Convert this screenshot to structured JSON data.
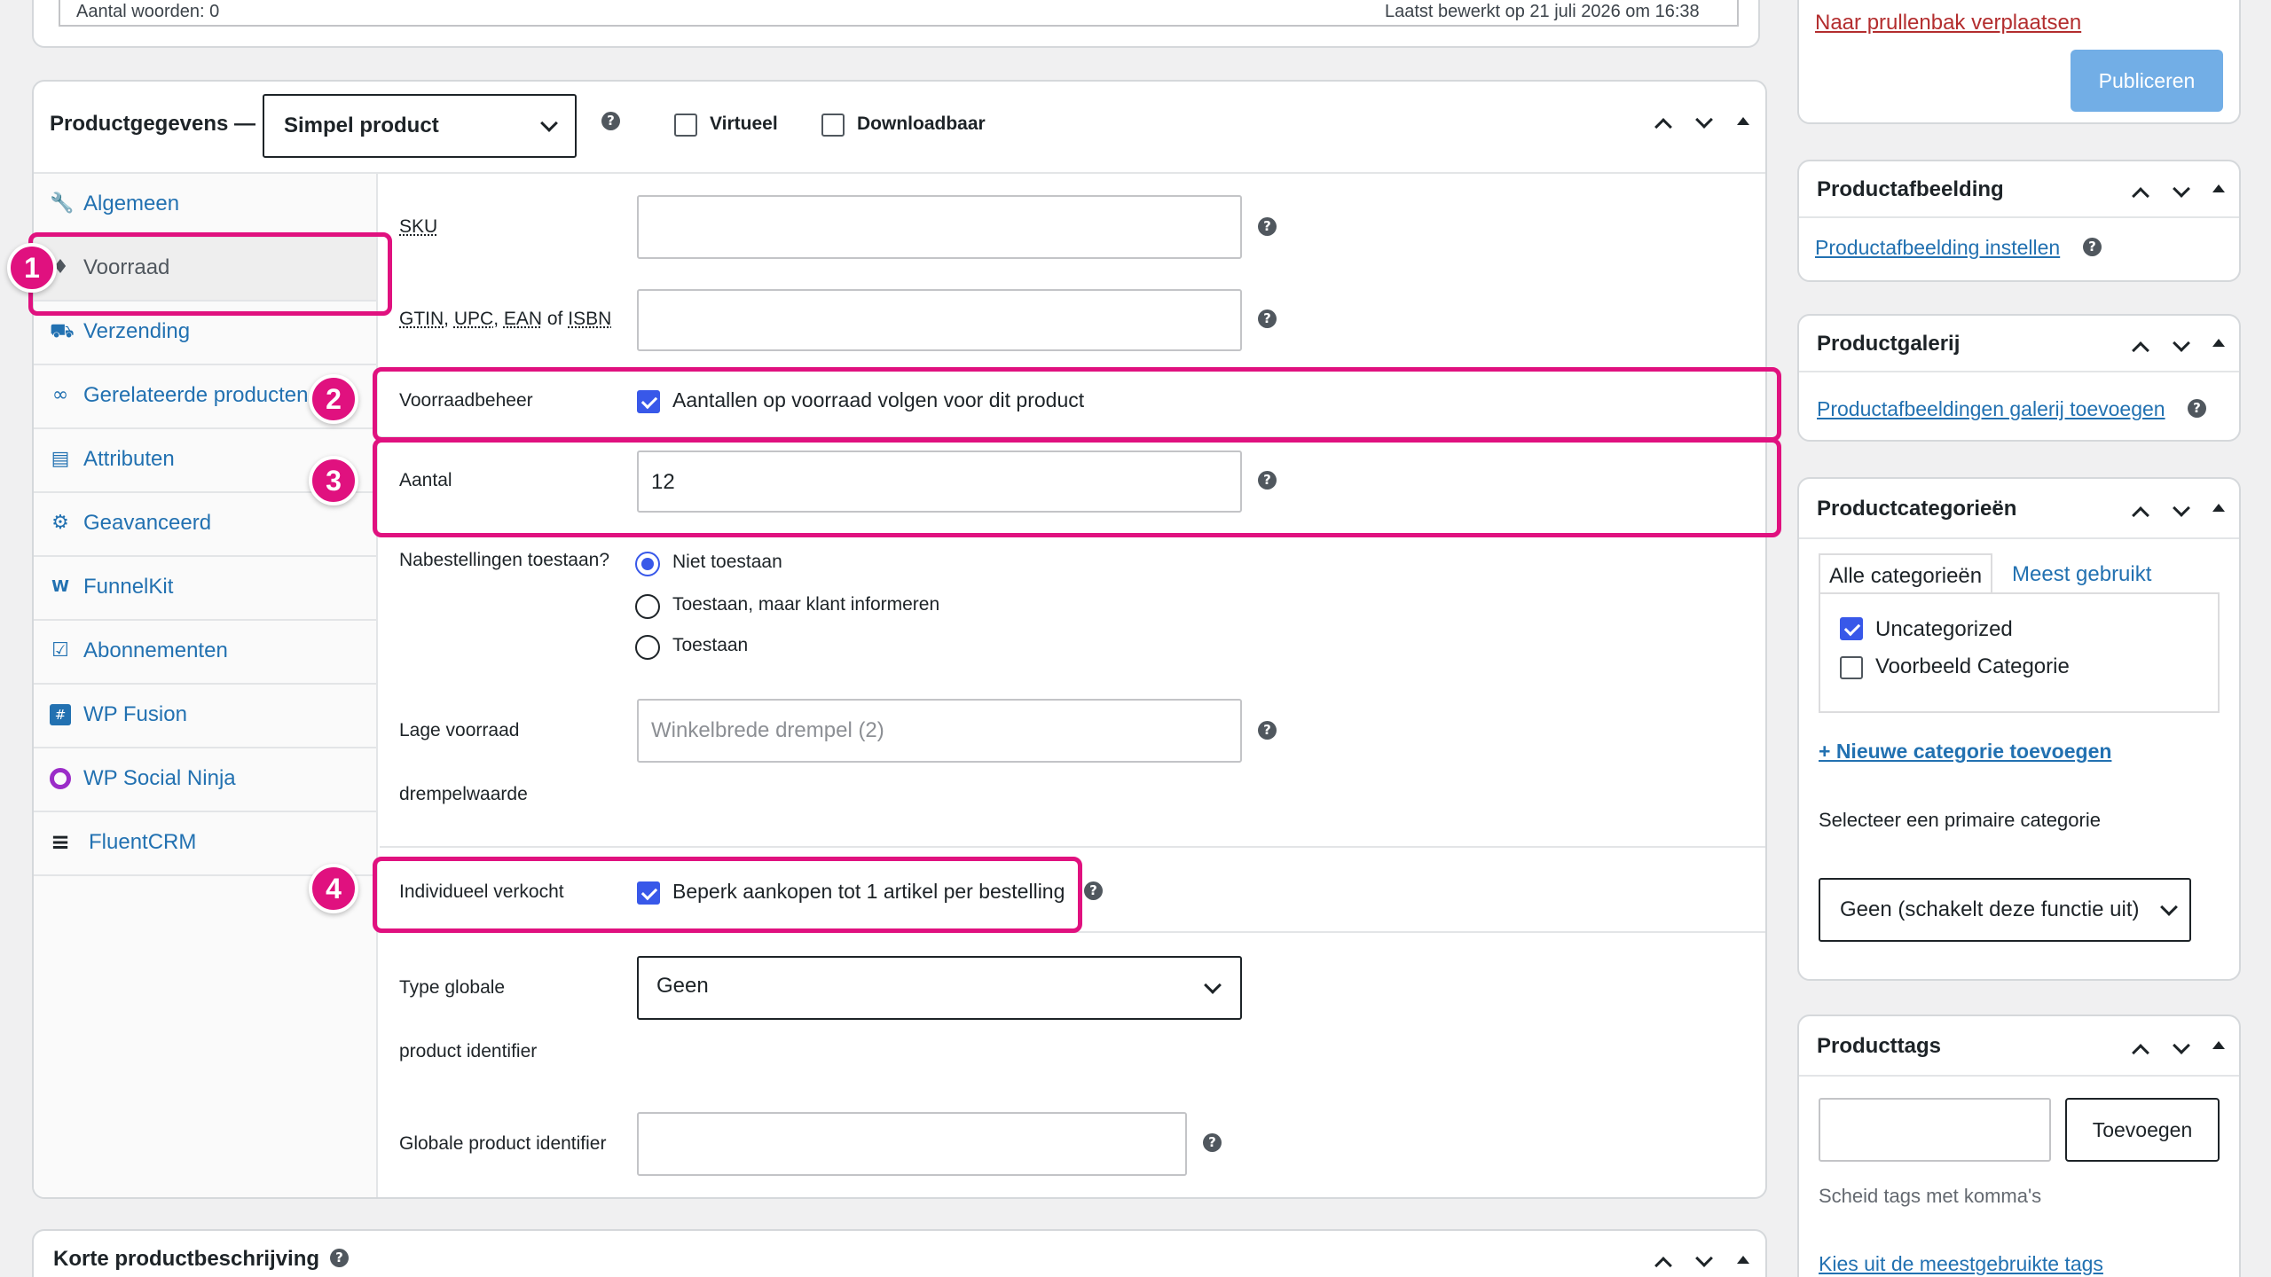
{
  "top_box": {
    "word_count": "Aantal woorden: 0",
    "last_edited": "Laatst bewerkt op 21 juli 2026 om 16:38"
  },
  "product_data": {
    "title": "Productgegevens —",
    "type_select": "Simpel product",
    "virtual_label": "Virtueel",
    "downloadable_label": "Downloadbaar",
    "tabs": [
      {
        "label": "Algemeen",
        "icon": "wrench-icon"
      },
      {
        "label": "Voorraad",
        "icon": "tag-icon"
      },
      {
        "label": "Verzending",
        "icon": "truck-icon"
      },
      {
        "label": "Gerelateerde producten",
        "icon": "link-icon"
      },
      {
        "label": "Attributen",
        "icon": "list-icon"
      },
      {
        "label": "Geavanceerd",
        "icon": "gear-icon"
      },
      {
        "label": "FunnelKit",
        "icon": "funnelkit-icon"
      },
      {
        "label": "Abonnementen",
        "icon": "calendar-icon"
      },
      {
        "label": "WP Fusion",
        "icon": "wp-fusion-icon"
      },
      {
        "label": "WP Social Ninja",
        "icon": "social-ninja-icon"
      },
      {
        "label": "FluentCRM",
        "icon": "fluentcrm-icon"
      }
    ],
    "fields": {
      "sku_label": "SKU",
      "gtin_label_parts": [
        "GTIN",
        ", ",
        "UPC",
        ", ",
        "EAN",
        " of ",
        "ISBN"
      ],
      "stock_mgmt_label": "Voorraadbeheer",
      "stock_mgmt_text": "Aantallen op voorraad volgen voor dit product",
      "quantity_label": "Aantal",
      "quantity_value": "12",
      "backorders_label": "Nabestellingen toestaan?",
      "backorder_options": [
        "Niet toestaan",
        "Toestaan, maar klant informeren",
        "Toestaan"
      ],
      "low_stock_label_1": "Lage voorraad",
      "low_stock_label_2": "drempelwaarde",
      "low_stock_placeholder": "Winkelbrede drempel (2)",
      "sold_individually_label": "Individueel verkocht",
      "sold_individually_text": "Beperk aankopen tot 1 artikel per bestelling",
      "global_id_type_label_1": "Type globale",
      "global_id_type_label_2": "product identifier",
      "global_id_type_value": "Geen",
      "global_id_label": "Globale product identifier"
    }
  },
  "short_description": {
    "title": "Korte productbeschrijving"
  },
  "sidebar": {
    "trash_link": "Naar prullenbak verplaatsen",
    "publish_button": "Publiceren",
    "product_image": {
      "title": "Productafbeelding",
      "link": "Productafbeelding instellen"
    },
    "gallery": {
      "title": "Productgalerij",
      "link": "Productafbeeldingen galerij toevoegen"
    },
    "categories": {
      "title": "Productcategorieën",
      "tab_all": "Alle categorieën",
      "tab_popular": "Meest gebruikt",
      "items": [
        {
          "label": "Uncategorized",
          "checked": true
        },
        {
          "label": "Voorbeeld Categorie",
          "checked": false
        }
      ],
      "add_link": "+ Nieuwe categorie toevoegen",
      "primary_label": "Selecteer een primaire categorie",
      "primary_select": "Geen (schakelt deze functie uit)"
    },
    "tags": {
      "title": "Producttags",
      "add_button": "Toevoegen",
      "hint": "Scheid tags met komma's",
      "choose_link": "Kies uit de meestgebruikte tags"
    }
  },
  "annotations": [
    "1",
    "2",
    "3",
    "4"
  ],
  "colors": {
    "highlight": "#e0117f",
    "link": "#2271b1",
    "checkbox": "#3858e9",
    "publish": "#72aee6"
  }
}
